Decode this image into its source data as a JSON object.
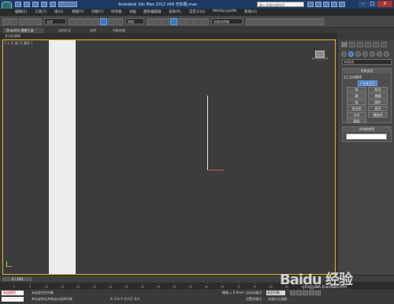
{
  "title_bar": {
    "title": "Autodesk 3ds Max 2012 x64    无标题.max",
    "search_placeholder": "键入关键字或短语"
  },
  "menu": [
    "编辑(E)",
    "工具(T)",
    "组(G)",
    "视图(V)",
    "创建(C)",
    "修改器",
    "动画",
    "图形编辑器",
    "渲染(R)",
    "自定义(U)",
    "MAXScript(M)",
    "帮助(H)"
  ],
  "toolbar": {
    "filter_select": "全部",
    "coord_select": "视图",
    "named_selection_placeholder": "创建选择集"
  },
  "ribbon": {
    "tabs": [
      "Graphite 建模工具",
      "自由形式",
      "选择",
      "对象绘制"
    ],
    "sub_label": "多边形建模"
  },
  "viewport": {
    "label": "[ + ] [ 前 ] [ 真实 ]"
  },
  "command_panel": {
    "dropdown": "样条线",
    "object_type_title": "对象类型",
    "auto_grid_label": "自动栅格",
    "start_new_shape": "开始新图形",
    "buttons": [
      "线",
      "矩形",
      "圆",
      "椭圆",
      "弧",
      "圆环",
      "多边形",
      "星形",
      "文本",
      "螺旋线",
      "截面"
    ],
    "active_button_index": 0,
    "name_color_title": "名称和颜色",
    "object_color": "#ffffff"
  },
  "timeline": {
    "counter": "0 / 100",
    "ticks": [
      "0",
      "5",
      "10",
      "15",
      "20",
      "25",
      "30",
      "35",
      "40",
      "45",
      "50",
      "55",
      "60",
      "65",
      "70",
      "75",
      "80",
      "85",
      "90",
      "95",
      "100"
    ]
  },
  "status": {
    "maxscript_label": "欢迎使用",
    "line1": "未选定任何对象",
    "line2": "单击或单击并拖动以选择对象",
    "coords": "X: 0.0    Y: 0.0    Z: 0.0",
    "grid": "栅格 = 0.0mm",
    "auto_key": "自动关键点",
    "auto_key_value": "选定对象",
    "set_key": "设置关键点",
    "key_filters": "关键点过滤器..."
  },
  "watermark": {
    "brand": "Baidu 经验",
    "url": "jingyan.baidu.com"
  }
}
